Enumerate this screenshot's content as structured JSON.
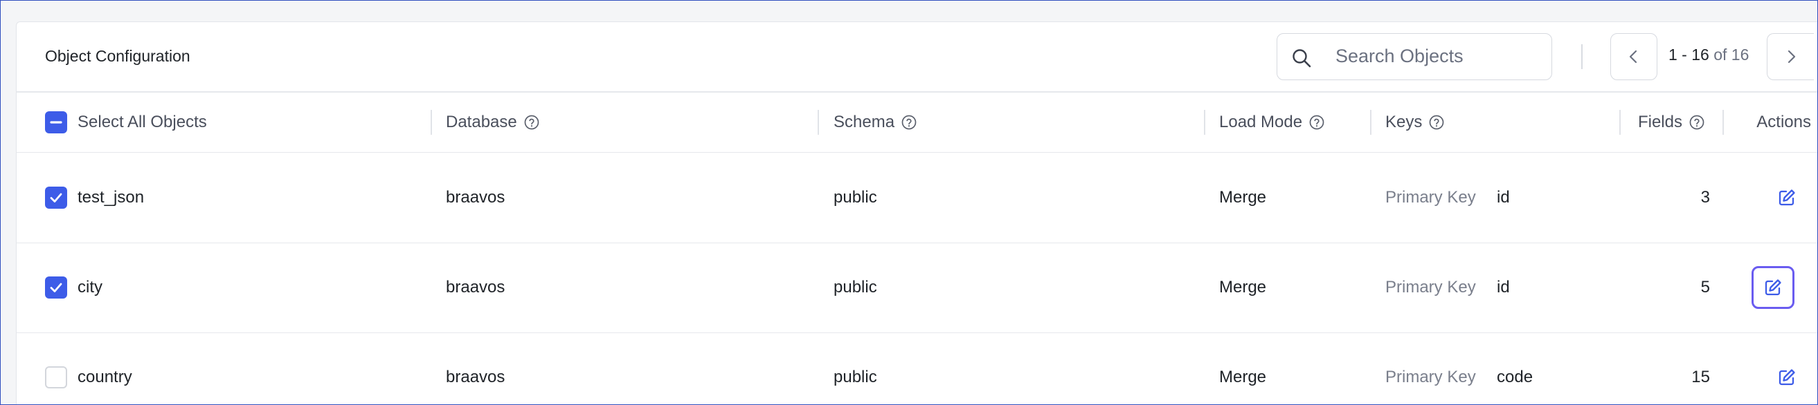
{
  "header": {
    "title": "Object Configuration",
    "search_placeholder": "Search Objects",
    "search_value": "",
    "pager_range": "1 - 16",
    "pager_of": "of 16"
  },
  "columns": {
    "select_all": "Select All Objects",
    "database": "Database",
    "schema": "Schema",
    "load_mode": "Load Mode",
    "keys": "Keys",
    "fields": "Fields",
    "actions": "Actions"
  },
  "rows": [
    {
      "checked": true,
      "name": "test_json",
      "database": "braavos",
      "schema": "public",
      "load_mode": "Merge",
      "key_type": "Primary Key",
      "key_value": "id",
      "fields": "3"
    },
    {
      "checked": true,
      "name": "city",
      "database": "braavos",
      "schema": "public",
      "load_mode": "Merge",
      "key_type": "Primary Key",
      "key_value": "id",
      "fields": "5"
    },
    {
      "checked": false,
      "name": "country",
      "database": "braavos",
      "schema": "public",
      "load_mode": "Merge",
      "key_type": "Primary Key",
      "key_value": "code",
      "fields": "15"
    }
  ],
  "icons": {
    "search": "search-icon",
    "prev": "chevron-left-icon",
    "next": "chevron-right-icon",
    "help": "help-circle-icon",
    "edit": "edit-icon",
    "select_all_state": "indeterminate-checkbox-icon"
  },
  "colors": {
    "accent": "#3d5ce8",
    "focus_ring": "#6a5cf0",
    "frame_border": "#2f4fbf"
  }
}
